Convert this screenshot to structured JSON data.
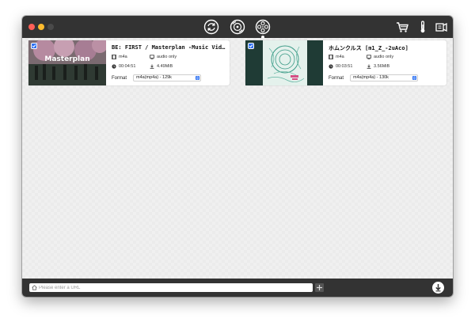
{
  "toolbar": {
    "icons": [
      "refresh-icon",
      "convert-disc-icon",
      "film-reel-icon",
      "cart-icon",
      "thermometer-icon",
      "plugin-icon"
    ],
    "active": "film-reel-icon"
  },
  "items": [
    {
      "title": "BE: FIRST / Masterplan -Music Video-",
      "thumbnail_text": "Masterplan",
      "container": "m4a",
      "stream": "audio only",
      "duration": "00:04:51",
      "size": "4.49MiB",
      "format_label": "Format",
      "format_value": "m4a(mp4a) - 129k",
      "checked": true
    },
    {
      "title": "ホムンクルス [m1_Z_-2uAco]",
      "container": "m4a",
      "stream": "audio only",
      "duration": "00:03:51",
      "size": "3.56MiB",
      "format_label": "Format",
      "format_value": "m4a(mp4a) - 130k",
      "checked": true
    }
  ],
  "bottom": {
    "url_placeholder": "Please enter a URL"
  },
  "colors": {
    "titlebar": "#333333",
    "accent": "#2a6ff2",
    "close": "#ff5f57",
    "minimize": "#febc2e"
  }
}
